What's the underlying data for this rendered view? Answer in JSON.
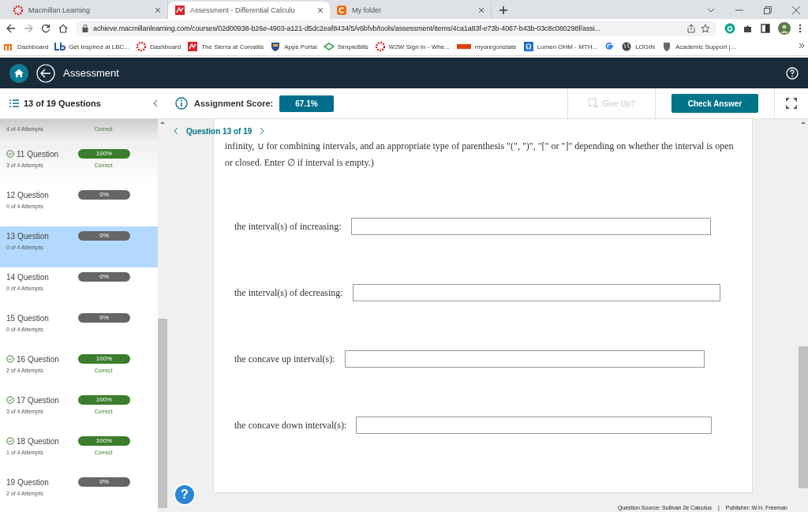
{
  "browser": {
    "tabs": [
      {
        "title": "Macmillan Learning",
        "selected": false
      },
      {
        "title": "Assessment - Differential Calculu",
        "selected": true
      },
      {
        "title": "My folder",
        "selected": false
      }
    ],
    "url": "achieve.macmillanlearning.com/courses/02d00938-b26e-4903-a121-d5dc2eaf8434/5/v6bfvb/tools/assessment/items/4ca1a83f-e73b-4067-b43b-03c8c080298f/assi...",
    "bookmarks": [
      "Dashboard",
      "Get Inspired at LBC...",
      "Dashboard",
      "The Sierra at Corvallis",
      "Apps Portal",
      "SimpleBills",
      "W2W Sign In - Whe...",
      "myoregonstate",
      "Lumen OHM - MTH...",
      "LOGIN",
      "Academic Support |..."
    ]
  },
  "app": {
    "title": "Assessment",
    "counter": "13 of 19 Questions",
    "score_label": "Assignment Score:",
    "score": "67.1%",
    "give_up": "Give Up?",
    "check": "Check Answer",
    "help": "?"
  },
  "questions": [
    {
      "attempts": "4 of 4 Attempts",
      "result": "Correct",
      "correct": true,
      "selected": false
    },
    {
      "label": "11 Question",
      "checked": true,
      "score": "100%",
      "correct": true,
      "attempts": "3 of 4 Attempts",
      "result": "Correct",
      "selected": false
    },
    {
      "label": "12 Question",
      "checked": false,
      "score": "0%",
      "correct": false,
      "attempts": "0 of 4 Attempts",
      "selected": false
    },
    {
      "label": "13 Question",
      "checked": false,
      "score": "0%",
      "correct": false,
      "attempts": "0 of 4 Attempts",
      "selected": true
    },
    {
      "label": "14 Question",
      "checked": false,
      "score": "0%",
      "correct": false,
      "attempts": "0 of 4 Attempts",
      "selected": false
    },
    {
      "label": "15 Question",
      "checked": false,
      "score": "0%",
      "correct": false,
      "attempts": "0 of 4 Attempts",
      "selected": false
    },
    {
      "label": "16 Question",
      "checked": true,
      "score": "100%",
      "correct": true,
      "attempts": "2 of 4 Attempts",
      "result": "Correct",
      "selected": false
    },
    {
      "label": "17 Question",
      "checked": true,
      "score": "100%",
      "correct": true,
      "attempts": "3 of 4 Attempts",
      "result": "Correct",
      "selected": false
    },
    {
      "label": "18 Question",
      "checked": true,
      "score": "100%",
      "correct": true,
      "attempts": "1 of 4 Attempts",
      "result": "Correct",
      "selected": false
    },
    {
      "label": "19 Question",
      "checked": false,
      "score": "0%",
      "correct": false,
      "attempts": "2 of 4 Attempts",
      "selected": false
    }
  ],
  "question": {
    "nav": "Question 13 of 19",
    "instructions": "infinity, ∪ for combining intervals, and an appropriate type of parenthesis \"(\", \")\", \"[\" or \"]\" depending on whether the interval is open or closed. Enter ∅ if interval is empty.)",
    "fields": [
      {
        "label": "the interval(s) of increasing:"
      },
      {
        "label": "the interval(s) of decreasing:"
      },
      {
        "label": "the concave up interval(s):"
      },
      {
        "label": "the concave down interval(s):"
      }
    ],
    "source": "Question Source: Sullivan 2e Calculus",
    "separator": "|",
    "publisher": "Publisher: W.H. Freeman"
  }
}
